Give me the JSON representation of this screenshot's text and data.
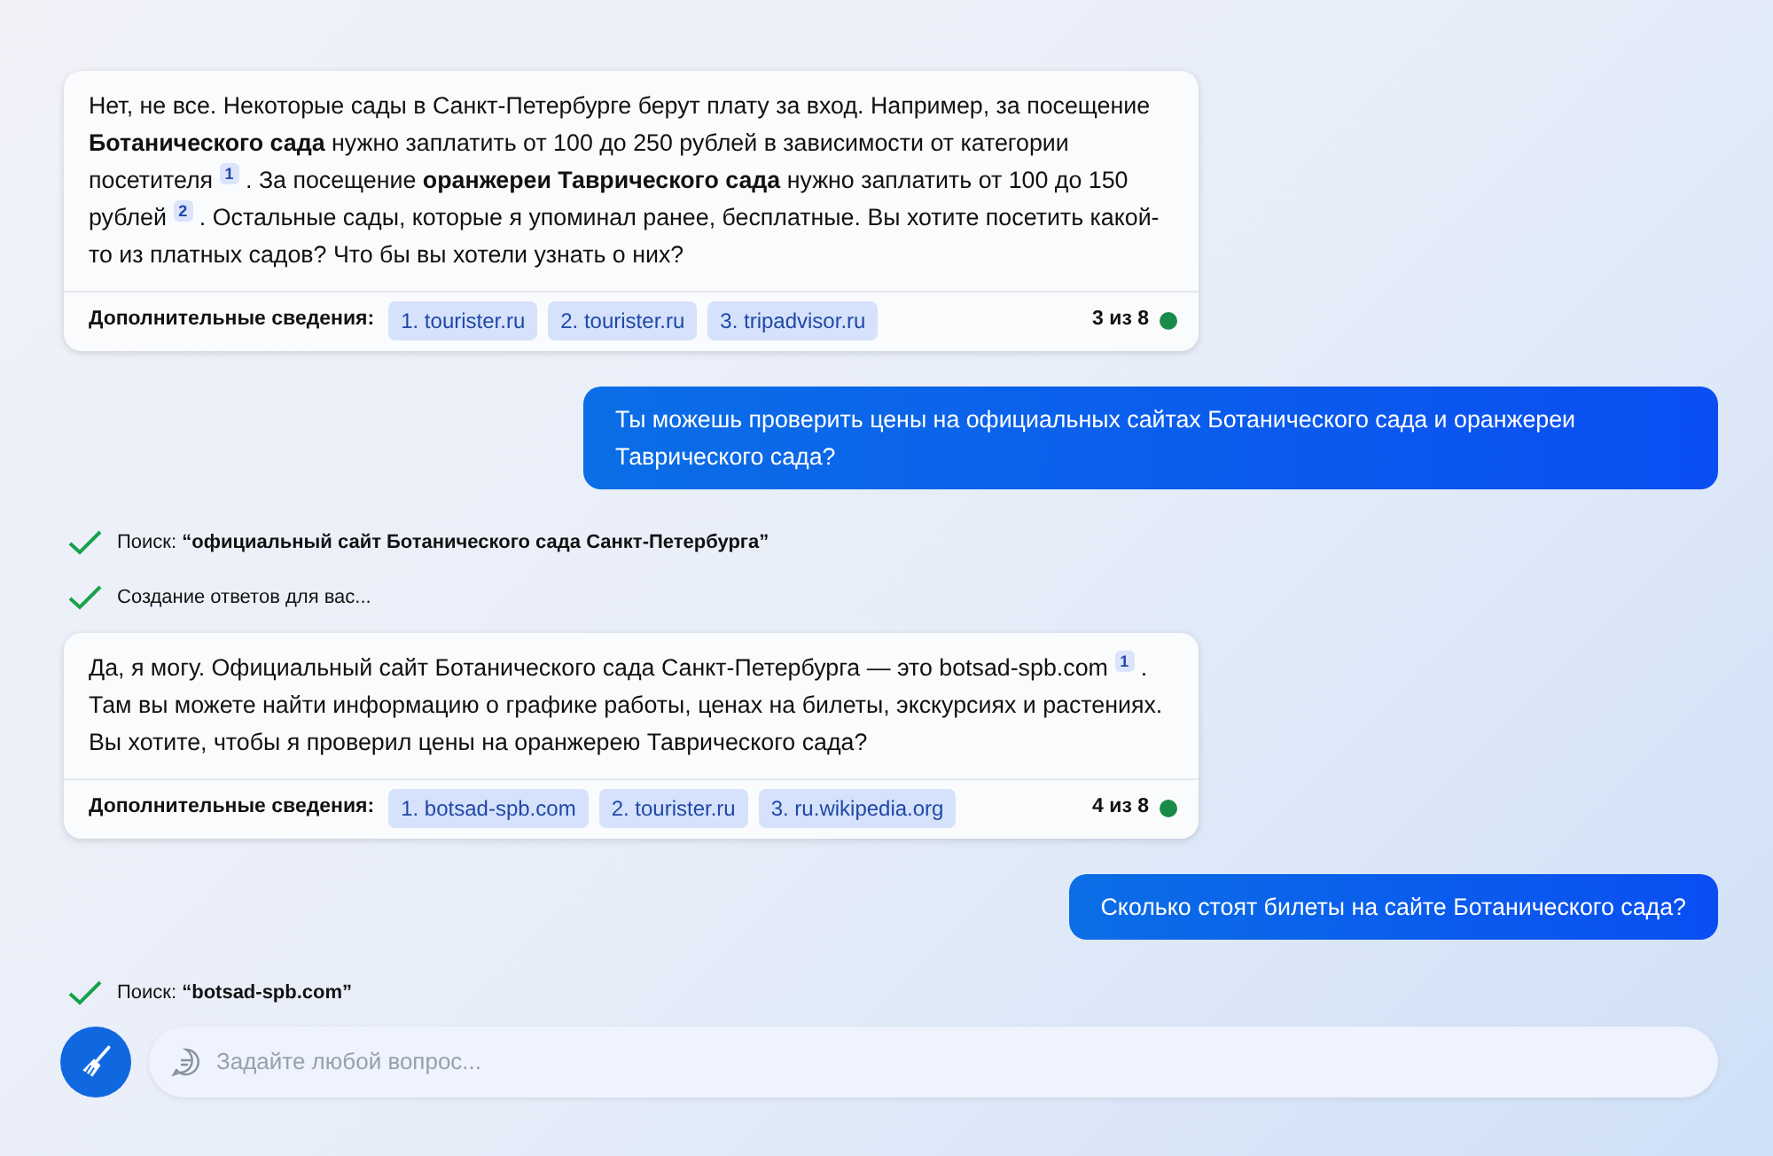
{
  "messages": [
    {
      "kind": "bot",
      "text": "Нет, не все. Некоторые сады в Санкт-Петербурге берут плату за вход. Например, за посещение **Ботанического сада** нужно заплатить от 100 до 250 рублей в зависимости от категории посетителя $^{1}$ . За посещение **оранжереи Таврического сада** нужно заплатить от 100 до 150 рублей $^{2}$ . Остальные сады, которые я упоминал ранее, бесплатные. Вы хотите посетить какой-то из платных садов? Что бы вы хотели узнать о них?",
      "sources_label": "Дополнительные сведения:",
      "sources": [
        "1. tourister.ru",
        "2. tourister.ru",
        "3. tripadvisor.ru"
      ],
      "counter": "3 из 8"
    },
    {
      "kind": "user",
      "text": "Ты можешь проверить цены на официальных сайтах Ботанического сада и оранжереи Таврического сада?"
    },
    {
      "kind": "status",
      "text": "Поиск: **“официальный сайт Ботанического сада Санкт-Петербурга”**"
    },
    {
      "kind": "status",
      "text": "Создание ответов для вас..."
    },
    {
      "kind": "bot",
      "text": "Да, я могу. Официальный сайт Ботанического сада Санкт-Петербурга — это botsad-spb.com $^{1}$ . Там вы можете найти информацию о графике работы, ценах на билеты, экскурсиях и растениях. Вы хотите, чтобы я проверил цены на оранжерею Таврического сада?",
      "sources_label": "Дополнительные сведения:",
      "sources": [
        "1. botsad-spb.com",
        "2. tourister.ru",
        "3. ru.wikipedia.org"
      ],
      "counter": "4 из 8"
    },
    {
      "kind": "user",
      "text": "Сколько стоят билеты на сайте Ботанического сада?"
    },
    {
      "kind": "status",
      "text": "Поиск: **“botsad-spb.com”**"
    }
  ],
  "input": {
    "placeholder": "Задайте любой вопрос..."
  }
}
